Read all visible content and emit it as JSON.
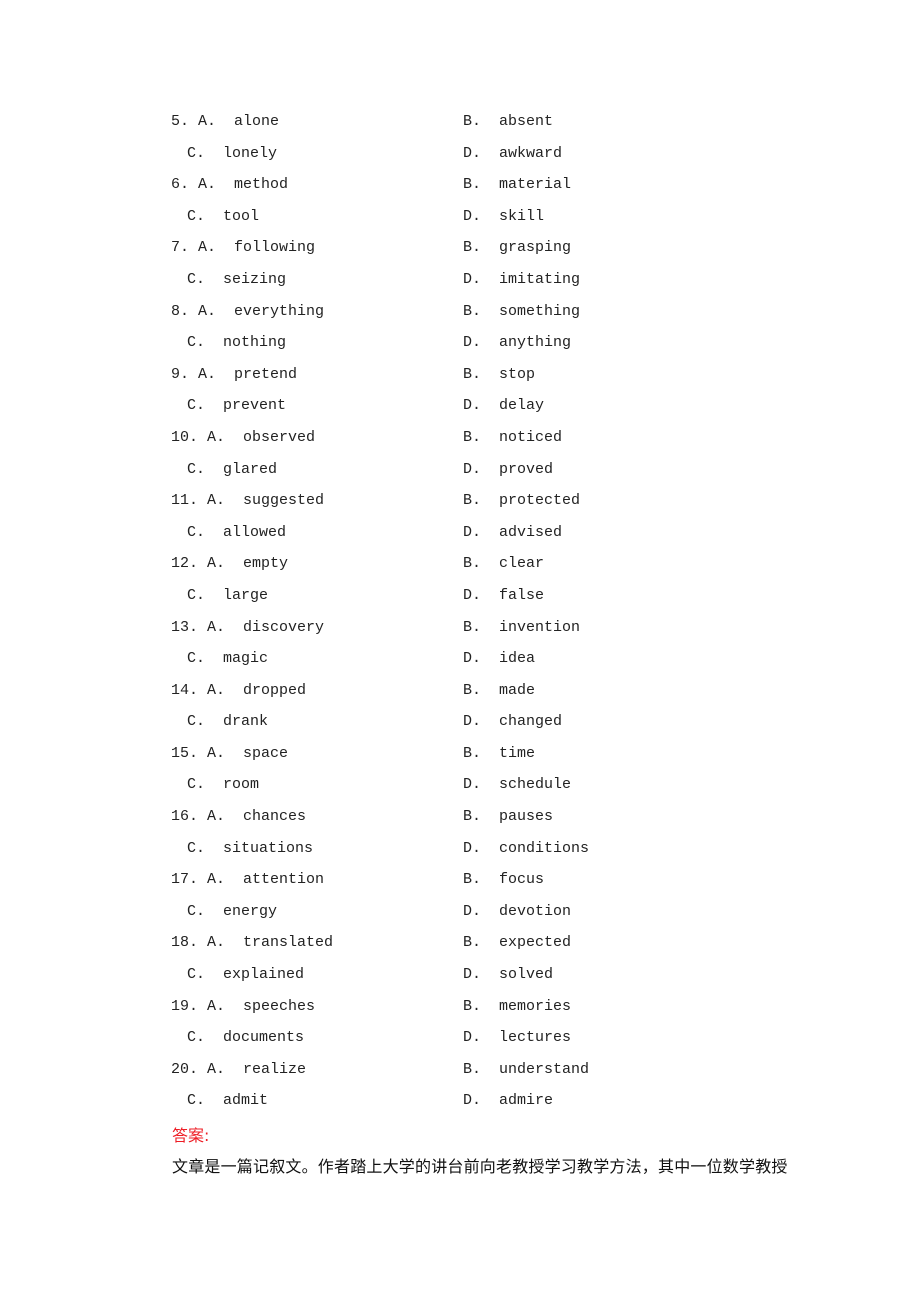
{
  "questions": [
    {
      "num": "5.",
      "A": "alone",
      "B": "absent",
      "C": "lonely",
      "D": "awkward"
    },
    {
      "num": "6.",
      "A": "method",
      "B": "material",
      "C": "tool",
      "D": "skill"
    },
    {
      "num": "7.",
      "A": "following",
      "B": "grasping",
      "C": "seizing",
      "D": "imitating"
    },
    {
      "num": "8.",
      "A": "everything",
      "B": "something",
      "C": "nothing",
      "D": "anything"
    },
    {
      "num": "9.",
      "A": "pretend",
      "B": "stop",
      "C": "prevent",
      "D": "delay"
    },
    {
      "num": "10.",
      "A": "observed",
      "B": "noticed",
      "C": "glared",
      "D": "proved"
    },
    {
      "num": "11.",
      "A": "suggested",
      "B": "protected",
      "C": "allowed",
      "D": "advised"
    },
    {
      "num": "12.",
      "A": "empty",
      "B": "clear",
      "C": "large",
      "D": "false"
    },
    {
      "num": "13.",
      "A": "discovery",
      "B": "invention",
      "C": "magic",
      "D": "idea"
    },
    {
      "num": "14.",
      "A": "dropped",
      "B": "made",
      "C": "drank",
      "D": "changed"
    },
    {
      "num": "15.",
      "A": "space",
      "B": "time",
      "C": "room",
      "D": "schedule"
    },
    {
      "num": "16.",
      "A": "chances",
      "B": "pauses",
      "C": "situations",
      "D": "conditions"
    },
    {
      "num": "17.",
      "A": "attention",
      "B": "focus",
      "C": "energy",
      "D": "devotion"
    },
    {
      "num": "18.",
      "A": "translated",
      "B": "expected",
      "C": "explained",
      "D": "solved"
    },
    {
      "num": "19.",
      "A": "speeches",
      "B": "memories",
      "C": "documents",
      "D": "lectures"
    },
    {
      "num": "20.",
      "A": "realize",
      "B": "understand",
      "C": "admit",
      "D": "admire"
    }
  ],
  "option_prefixes": {
    "A": "A.",
    "B": "B.",
    "C": "C.",
    "D": "D."
  },
  "answer": {
    "label": "答案:",
    "label_color": "#ee1c24",
    "paragraph": "文章是一篇记叙文。作者踏上大学的讲台前向老教授学习教学方法，其中一位数学教授"
  }
}
